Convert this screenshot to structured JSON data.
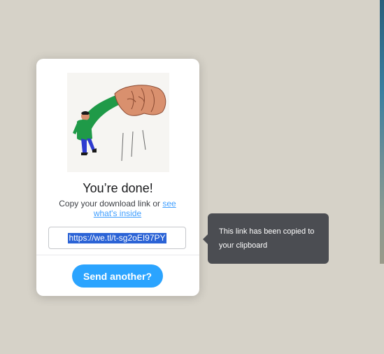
{
  "dialog": {
    "title": "You’re done!",
    "subtitle_prefix": "Copy your download link or",
    "subtitle_link": "see what's inside",
    "download_link": "https://we.tl/t-sg2oEI97PY",
    "send_button": "Send another?"
  },
  "tooltip": {
    "message": "This link has been copied to your clipboard"
  },
  "illustration": {
    "icon": "hand-dropping-person-illustration"
  },
  "colors": {
    "background": "#d6d2c8",
    "accent": "#2ba4ff",
    "link": "#409fff",
    "selection": "#2b63d6",
    "tooltip_bg": "#4b4d52"
  }
}
